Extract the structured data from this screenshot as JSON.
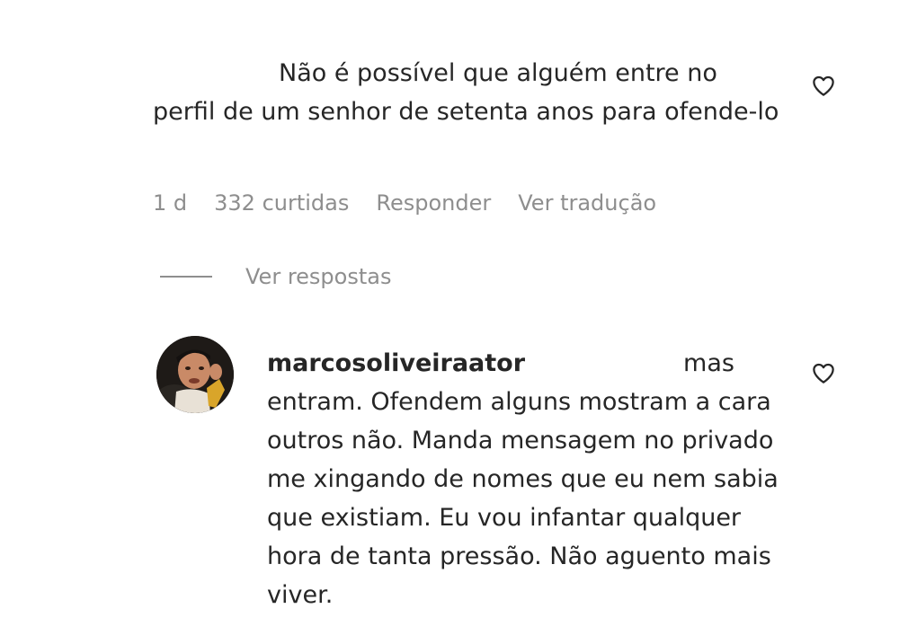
{
  "comment1": {
    "text": "Não é possível que alguém entre no perfil de um senhor de setenta anos para ofende-lo",
    "time": "1 d",
    "likes": "332 curtidas",
    "reply_label": "Responder",
    "translate_label": "Ver tradução",
    "like_icon": "heart-outline-icon"
  },
  "replies_toggle": {
    "label": "Ver respostas"
  },
  "comment2": {
    "username": "marcosoliveiraator",
    "text": "mas entram. Ofendem alguns mostram a cara outros não. Manda mensagem no privado me xingando de nomes que eu nem sabia que existiam. Eu vou infantar qualquer hora de tanta pressão. Não aguento mais viver.",
    "like_icon": "heart-outline-icon"
  },
  "colors": {
    "text_primary": "#262626",
    "text_secondary": "#8e8e8e",
    "background": "#ffffff"
  }
}
